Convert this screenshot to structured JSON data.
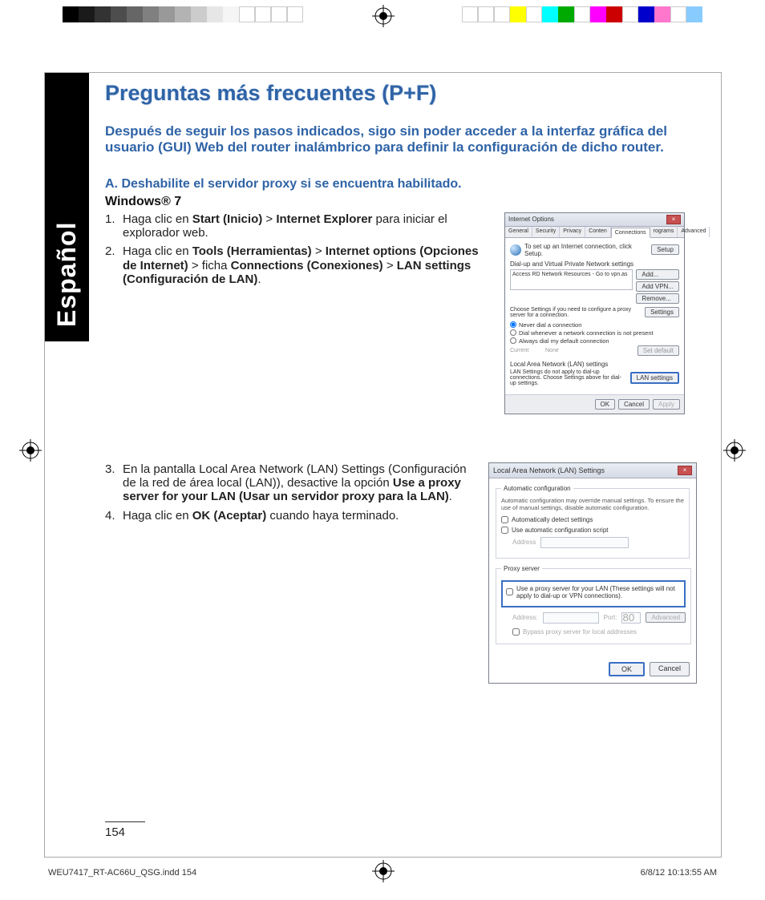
{
  "language_tab": "Español",
  "title": "Preguntas más frecuentes (P+F)",
  "intro": "Después de seguir los pasos indicados, sigo sin poder acceder a la interfaz gráfica del usuario (GUI) Web del router inalámbrico para definir la configuración de dicho router.",
  "step_a_label": "A.   Deshabilite el servidor proxy si se encuentra habilitado.",
  "os_label": "Windows® 7",
  "list1": {
    "item1_pre": "Haga clic en ",
    "item1_b1": "Start (Inicio)",
    "item1_gt": " > ",
    "item1_b2": "Internet Explorer",
    "item1_post": " para iniciar el explorador web.",
    "item2_pre": "Haga clic en ",
    "item2_b1": "Tools (Herramientas)",
    "item2_gt1": " > ",
    "item2_b2": "Internet options (Opciones de Internet)",
    "item2_gt2": " > ficha ",
    "item2_b3": "Connections (Conexiones)",
    "item2_gt3": " > ",
    "item2_b4": "LAN settings (Configuración de LAN)",
    "item2_post": "."
  },
  "list2": {
    "item3_pre": "En la pantalla Local Area Network (LAN) Settings (Configuración de la red de área local (LAN)), desactive la opción ",
    "item3_b1": "Use a proxy server for your LAN (Usar un servidor proxy para la LAN)",
    "item3_post": ".",
    "item4_pre": "Haga clic en ",
    "item4_b1": "OK (Aceptar)",
    "item4_post": " cuando haya terminado."
  },
  "page_number": "154",
  "footer_left": "WEU7417_RT-AC66U_QSG.indd   154",
  "footer_right": "6/8/12   10:13:55 AM",
  "shot1": {
    "title": "Internet Options",
    "tabs": [
      "General",
      "Security",
      "Privacy",
      "Conten",
      "Connections",
      "rograms",
      "Advanced"
    ],
    "setup_text": "To set up an Internet connection, click Setup.",
    "setup_btn": "Setup",
    "group1": "Dial-up and Virtual Private Network settings",
    "list_entry": "Access RD Network Resources - Go to vpn.as",
    "add_btn": "Add...",
    "addvpn_btn": "Add VPN...",
    "remove_btn": "Remove...",
    "settings_hint": "Choose Settings if you need to configure a proxy server for a connection.",
    "settings_btn": "Settings",
    "radio1": "Never dial a connection",
    "radio2": "Dial whenever a network connection is not present",
    "radio3": "Always dial my default connection",
    "current": "Current",
    "none": "None",
    "setdefault_btn": "Set default",
    "group2": "Local Area Network (LAN) settings",
    "lan_hint": "LAN Settings do not apply to dial-up connections. Choose Settings above for dial-up settings.",
    "lan_btn": "LAN settings",
    "ok": "OK",
    "cancel": "Cancel",
    "apply": "Apply"
  },
  "shot2": {
    "title": "Local Area Network (LAN) Settings",
    "auto_hdr": "Automatic configuration",
    "auto_text": "Automatic configuration may override manual settings. To ensure the use of manual settings, disable automatic configuration.",
    "auto_detect": "Automatically detect settings",
    "auto_script": "Use automatic configuration script",
    "address": "Address",
    "proxy_hdr": "Proxy server",
    "proxy_check": "Use a proxy server for your LAN (These settings will not apply to dial-up or VPN connections).",
    "proxy_addr": "Address:",
    "proxy_port": "Port:",
    "port_val": "80",
    "advanced": "Advanced",
    "bypass": "Bypass proxy server for local addresses",
    "ok": "OK",
    "cancel": "Cancel"
  }
}
